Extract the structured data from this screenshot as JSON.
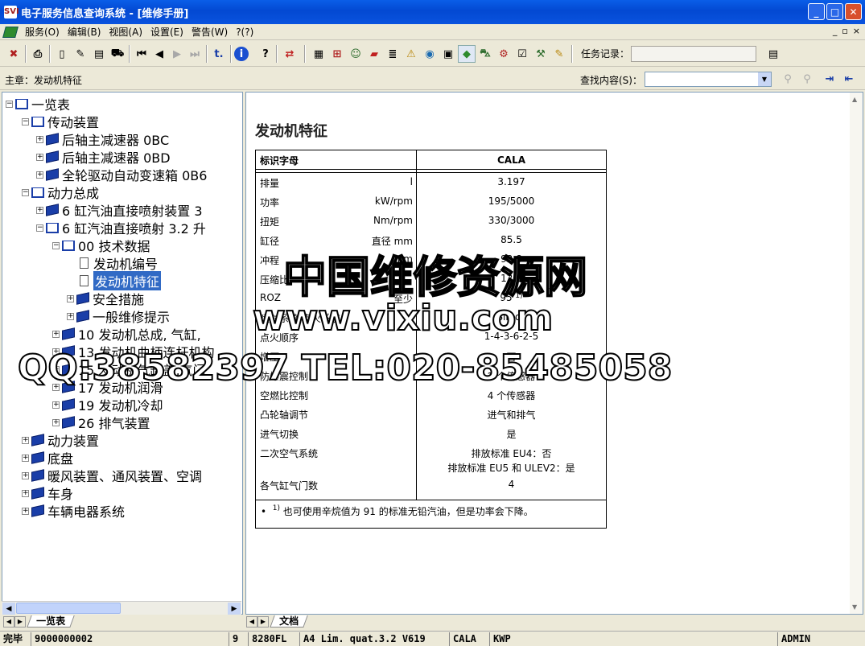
{
  "window": {
    "title": "电子服务信息查询系统 - [维修手册]",
    "app_icon": "SVI"
  },
  "menu": [
    "服务(O)",
    "编辑(B)",
    "视图(A)",
    "设置(E)",
    "警告(W)",
    "?(?)"
  ],
  "toolbar": {
    "task_label": "任务记录：",
    "task_value": "",
    "refresh_glyph": "⇄"
  },
  "search": {
    "chapter": "主章：发动机特征",
    "label": "查找内容(S)：",
    "value": ""
  },
  "tree": [
    {
      "label": "一览表",
      "level": 0,
      "toggle": "−",
      "icon": "book-open"
    },
    {
      "label": "传动装置",
      "level": 1,
      "toggle": "−",
      "icon": "book-open"
    },
    {
      "label": "后轴主减速器 0BC",
      "level": 2,
      "toggle": "+",
      "icon": "book"
    },
    {
      "label": "后轴主减速器 0BD",
      "level": 2,
      "toggle": "+",
      "icon": "book"
    },
    {
      "label": "全轮驱动自动变速箱 0B6",
      "level": 2,
      "toggle": "+",
      "icon": "book"
    },
    {
      "label": "动力总成",
      "level": 1,
      "toggle": "−",
      "icon": "book-open"
    },
    {
      "label": "6 缸汽油直接喷射装置 3",
      "level": 2,
      "toggle": "+",
      "icon": "book"
    },
    {
      "label": "6 缸汽油直接喷射 3.2 升",
      "level": 2,
      "toggle": "−",
      "icon": "book-open"
    },
    {
      "label": "00 技术数据",
      "level": 3,
      "toggle": "−",
      "icon": "book-open"
    },
    {
      "label": "发动机编号",
      "level": 4,
      "toggle": "",
      "icon": "document"
    },
    {
      "label": "发动机特征",
      "level": 4,
      "toggle": "",
      "icon": "document",
      "selected": true
    },
    {
      "label": "安全措施",
      "level": 4,
      "toggle": "+",
      "icon": "book"
    },
    {
      "label": "一般维修提示",
      "level": 4,
      "toggle": "+",
      "icon": "book"
    },
    {
      "label": "10 发动机总成, 气缸,",
      "level": 3,
      "toggle": "+",
      "icon": "book"
    },
    {
      "label": "13 发动机曲柄连杆机构",
      "level": 3,
      "toggle": "+",
      "icon": "book"
    },
    {
      "label": "15 发动机气缸盖,气门",
      "level": 3,
      "toggle": "+",
      "icon": "book"
    },
    {
      "label": "17 发动机润滑",
      "level": 3,
      "toggle": "+",
      "icon": "book"
    },
    {
      "label": "19 发动机冷却",
      "level": 3,
      "toggle": "+",
      "icon": "book"
    },
    {
      "label": "26 排气装置",
      "level": 3,
      "toggle": "+",
      "icon": "book"
    },
    {
      "label": "动力装置",
      "level": 1,
      "toggle": "+",
      "icon": "book"
    },
    {
      "label": "底盘",
      "level": 1,
      "toggle": "+",
      "icon": "book"
    },
    {
      "label": "暖风装置、通风装置、空调",
      "level": 1,
      "toggle": "+",
      "icon": "book"
    },
    {
      "label": "车身",
      "level": 1,
      "toggle": "+",
      "icon": "book"
    },
    {
      "label": "车辆电器系统",
      "level": 1,
      "toggle": "+",
      "icon": "book"
    }
  ],
  "document": {
    "title": "发动机特征",
    "header_key": "标识字母",
    "header_value": "CALA",
    "rows": [
      {
        "label": "排量",
        "unit": "l",
        "value": "3.197"
      },
      {
        "label": "功率",
        "unit": "kW/rpm",
        "value": "195/5000"
      },
      {
        "label": "扭矩",
        "unit": "Nm/rpm",
        "value": "330/3000"
      },
      {
        "label": "缸径",
        "unit": "直径 mm",
        "value": "85.5"
      },
      {
        "label": "冲程",
        "unit": "mm",
        "value": "92.8"
      },
      {
        "label": "压缩比",
        "unit": "",
        "value": "12.5"
      },
      {
        "label": "ROZ",
        "unit": "至少",
        "value": "95",
        "sup": "1)"
      },
      {
        "label": "喷射系统 点火系统",
        "unit": "",
        "value": "Simos"
      },
      {
        "label": "点火顺序",
        "unit": "",
        "value": "1-4-3-6-2-5"
      },
      {
        "label": "增压",
        "unit": "",
        "value": "否"
      },
      {
        "label": "防爆震控制",
        "unit": "",
        "value": "2 个传感器"
      },
      {
        "label": "空燃比控制",
        "unit": "",
        "value": "4 个传感器"
      },
      {
        "label": "凸轮轴调节",
        "unit": "",
        "value": "进气和排气"
      },
      {
        "label": "进气切换",
        "unit": "",
        "value": "是"
      },
      {
        "label": "二次空气系统",
        "unit": "",
        "value": "排放标准 EU4：否",
        "value2": "排放标准 EU5 和 ULEV2：是"
      },
      {
        "label": "各气缸气门数",
        "unit": "",
        "value": "4"
      }
    ],
    "footnote_bullet": "•",
    "footnote_mark": "1)",
    "footnote": "也可使用辛烷值为 91 的标准无铅汽油，但是功率会下降。"
  },
  "tabs": {
    "left": "一览表",
    "right": "文档"
  },
  "statusbar": [
    "完毕",
    "9000000002",
    "9",
    "8280FL",
    "A4 Lim. quat.3.2 V619",
    "CALA",
    "KWP",
    "ADMIN"
  ],
  "watermark": {
    "line1": "中国维修资源网",
    "line2": "www.vixiu.com",
    "line3": "QQ:38582397 TEL:020-85485058"
  }
}
